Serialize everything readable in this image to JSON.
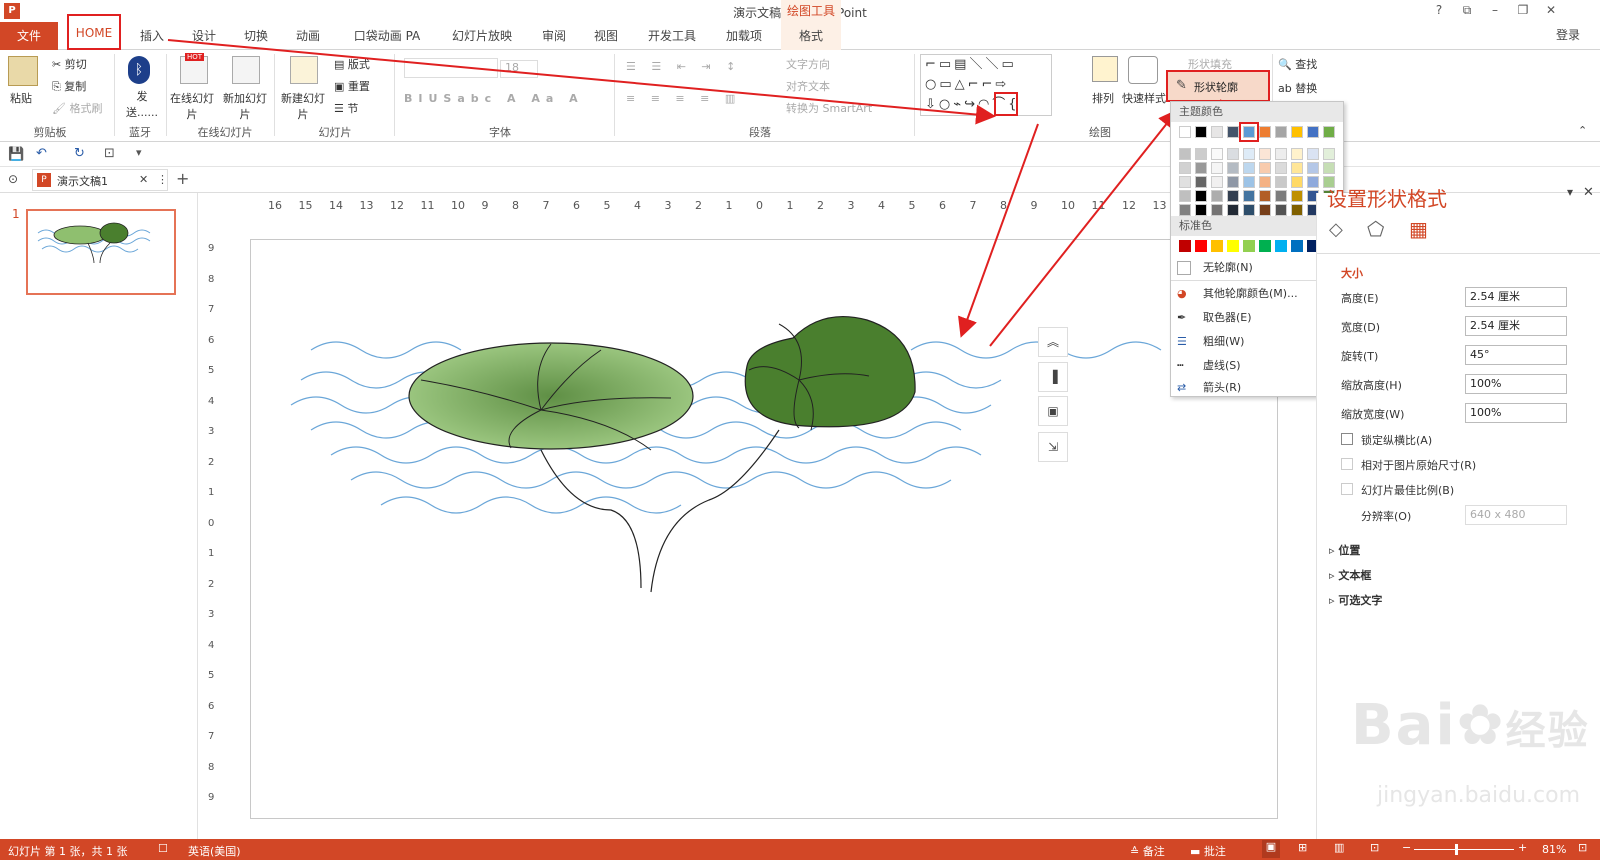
{
  "app": {
    "title": "演示文稿1 - PowerPoint",
    "login": "登录",
    "help": "?"
  },
  "tabs": {
    "file": "文件",
    "home": "HOME",
    "insert": "插入",
    "design": "设计",
    "transitions": "切换",
    "animations": "动画",
    "pocket": "口袋动画 PA",
    "slideshow": "幻灯片放映",
    "review": "审阅",
    "view": "视图",
    "developer": "开发工具",
    "addins": "加载项",
    "drawing_tools": "绘图工具",
    "format": "格式"
  },
  "ribbon": {
    "paste": "粘贴",
    "cut": "剪切",
    "copy": "复制",
    "format_painter": "格式刷",
    "clipboard": "剪贴板",
    "send": "发送......",
    "bluetooth": "蓝牙",
    "online_slides": "在线幻灯片",
    "new_online": "新加幻灯片",
    "online_group": "在线幻灯片",
    "new_slide": "新建幻灯片",
    "layout": "版式",
    "reset": "重置",
    "section": "节",
    "slides_group": "幻灯片",
    "font_group": "字体",
    "paragraph_group": "段落",
    "text_direction": "文字方向",
    "align_text": "对齐文本",
    "smartart": "转换为 SmartArt",
    "arrange": "排列",
    "quick_styles": "快速样式",
    "drawing_group": "绘图",
    "shape_fill": "形状填充",
    "shape_outline": "形状轮廓",
    "find": "查找",
    "replace": "替换",
    "font_size": "18",
    "hot": "HOT"
  },
  "doctab": {
    "name": "演示文稿1"
  },
  "slide_panel": {
    "number": "1"
  },
  "ruler": {
    "h": [
      "16",
      "15",
      "14",
      "13",
      "12",
      "11",
      "10",
      "9",
      "8",
      "7",
      "6",
      "5",
      "4",
      "3",
      "2",
      "1",
      "0",
      "1",
      "2",
      "3",
      "4",
      "5",
      "6",
      "7",
      "8",
      "9",
      "10",
      "11",
      "12",
      "13"
    ],
    "v": [
      "9",
      "8",
      "7",
      "6",
      "5",
      "4",
      "3",
      "2",
      "1",
      "0",
      "1",
      "2",
      "3",
      "4",
      "5",
      "6",
      "7",
      "8",
      "9"
    ]
  },
  "dropdown": {
    "theme_colors": "主题颜色",
    "standard_colors": "标准色",
    "no_outline": "无轮廓(N)",
    "more_colors": "其他轮廓颜色(M)...",
    "eyedropper": "取色器(E)",
    "weight": "粗细(W)",
    "dashes": "虚线(S)",
    "arrows": "箭头(R)",
    "theme_top": [
      "#ffffff",
      "#000000",
      "#e7e6e6",
      "#44546a",
      "#5b9bd5",
      "#ed7d31",
      "#a5a5a5",
      "#ffc000",
      "#4472c4",
      "#70ad47"
    ],
    "standard": [
      "#c00000",
      "#ff0000",
      "#ffc000",
      "#ffff00",
      "#92d050",
      "#00b050",
      "#00b0f0",
      "#0070c0",
      "#002060",
      "#7030a0"
    ]
  },
  "format_pane": {
    "title": "设置形状格式",
    "size": "大小",
    "height_label": "高度(E)",
    "height": "2.54 厘米",
    "width_label": "宽度(D)",
    "width": "2.54 厘米",
    "rotate_label": "旋转(T)",
    "rotate": "45°",
    "scale_h_label": "缩放高度(H)",
    "scale_h": "100%",
    "scale_w_label": "缩放宽度(W)",
    "scale_w": "100%",
    "lock_ratio": "锁定纵横比(A)",
    "relative": "相对于图片原始尺寸(R)",
    "best_scale": "幻灯片最佳比例(B)",
    "resolution_label": "分辨率(O)",
    "resolution": "640 x 480",
    "position": "位置",
    "textbox": "文本框",
    "alt_text": "可选文字"
  },
  "status": {
    "slide": "幻灯片 第 1 张，共 1 张",
    "lang": "英语(美国)",
    "notes": "备注",
    "comments": "批注",
    "zoom": "81%"
  },
  "watermark": {
    "brand": "Bai",
    "brand2": "经验",
    "url": "jingyan.baidu.com"
  },
  "colors": {
    "accent": "#d24726",
    "arrow": "#e02020",
    "leaf_light": "#9ccc7e",
    "leaf_dark": "#4a7f2e",
    "wave": "#6aa6d8"
  }
}
